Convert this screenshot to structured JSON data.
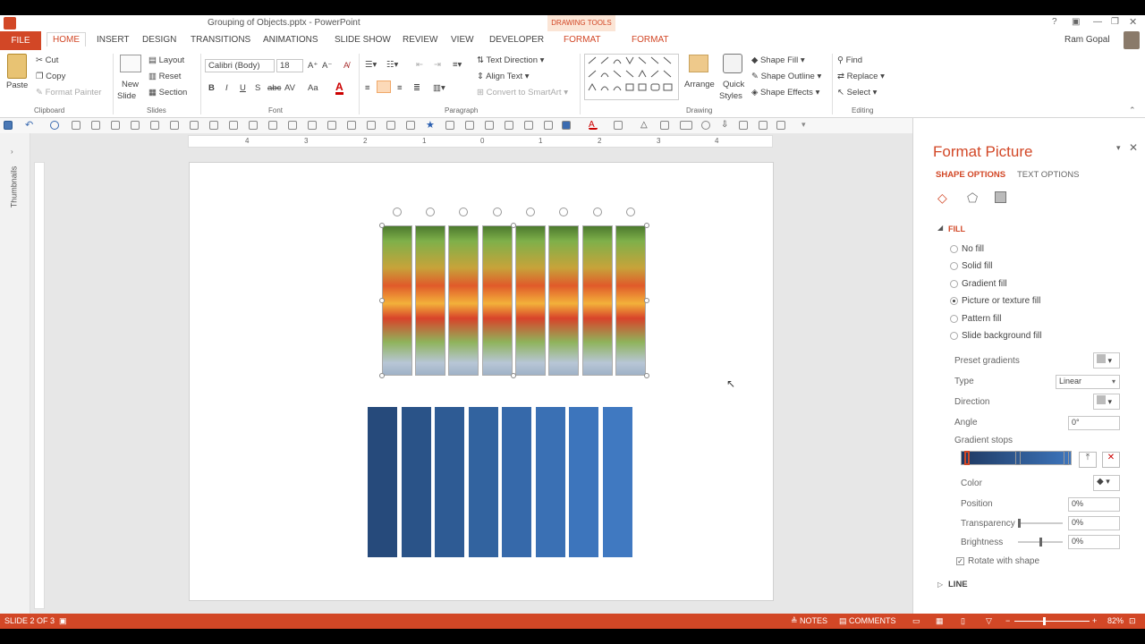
{
  "title": {
    "doc": "Grouping of Objects.pptx - PowerPoint",
    "context_group": "DRAWING TOOLS"
  },
  "tabs": [
    "FILE",
    "HOME",
    "INSERT",
    "DESIGN",
    "TRANSITIONS",
    "ANIMATIONS",
    "SLIDE SHOW",
    "REVIEW",
    "VIEW",
    "DEVELOPER",
    "FORMAT",
    "FORMAT"
  ],
  "user": "Ram Gopal",
  "clipboard": {
    "paste": "Paste",
    "cut": "Cut",
    "copy": "Copy",
    "format_painter": "Format Painter",
    "label": "Clipboard"
  },
  "slides": {
    "new_slide_1": "New",
    "new_slide_2": "Slide",
    "layout": "Layout",
    "reset": "Reset",
    "section": "Section",
    "label": "Slides"
  },
  "font": {
    "name": "Calibri (Body)",
    "size": "18",
    "label": "Font",
    "bold": "B",
    "italic": "I",
    "underline": "U",
    "shadow": "S",
    "strike": "abc",
    "spacing": "AV",
    "case": "Aa",
    "color": "A"
  },
  "paragraph": {
    "text_direction": "Text Direction",
    "align_text": "Align Text",
    "convert": "Convert to SmartArt",
    "label": "Paragraph"
  },
  "drawing": {
    "arrange": "Arrange",
    "quick_styles_1": "Quick",
    "quick_styles_2": "Styles",
    "shape_fill": "Shape Fill",
    "shape_outline": "Shape Outline",
    "shape_effects": "Shape Effects",
    "label": "Drawing"
  },
  "editing": {
    "find": "Find",
    "replace": "Replace",
    "select": "Select",
    "label": "Editing"
  },
  "thumbnails": "Thumbnails",
  "ruler_marks": [
    "4",
    "3",
    "2",
    "1",
    "0",
    "1",
    "2",
    "3",
    "4"
  ],
  "panel": {
    "title": "Format Picture",
    "tab_shape": "SHAPE OPTIONS",
    "tab_text": "TEXT OPTIONS",
    "fill_header": "FILL",
    "options": [
      "No fill",
      "Solid fill",
      "Gradient fill",
      "Picture or texture fill",
      "Pattern fill",
      "Slide background fill"
    ],
    "selected_option": "Picture or texture fill",
    "preset": "Preset gradients",
    "type_label": "Type",
    "type_value": "Linear",
    "direction": "Direction",
    "angle": "Angle",
    "angle_value": "0°",
    "gradient_stops": "Gradient stops",
    "color": "Color",
    "position": "Position",
    "position_value": "0%",
    "transparency": "Transparency",
    "transparency_value": "0%",
    "brightness": "Brightness",
    "brightness_value": "0%",
    "rotate": "Rotate with shape",
    "line_header": "LINE"
  },
  "status": {
    "slide": "SLIDE 2 OF 3",
    "notes": "NOTES",
    "comments": "COMMENTS",
    "zoom": "82%"
  },
  "colors": {
    "accent": "#d24726",
    "bars": [
      "#264a7b",
      "#2a5388",
      "#2e5b94",
      "#32639f",
      "#3669aa",
      "#3a70b4",
      "#3d75bc",
      "#4079c1"
    ]
  }
}
